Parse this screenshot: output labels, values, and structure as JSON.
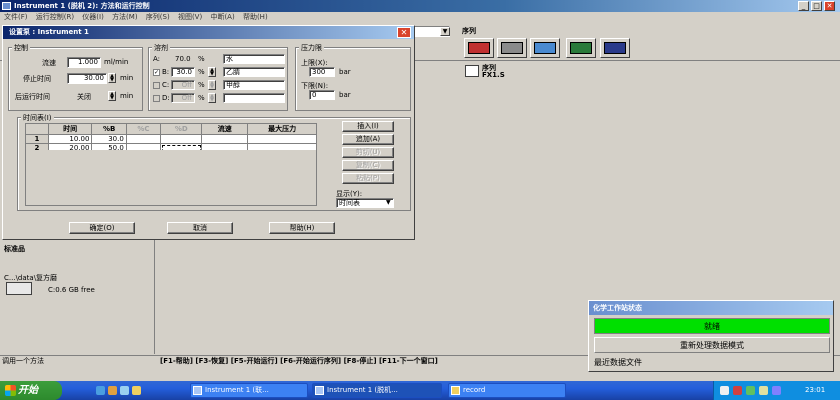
{
  "app": {
    "title": "Instrument 1 (脱机 2): 方法和运行控制",
    "menus": [
      "文件(F)",
      "运行控制(R)",
      "仪器(I)",
      "方法(M)",
      "序列(S)",
      "视图(V)",
      "中断(A)",
      "帮助(H)"
    ],
    "window_buttons": {
      "minimize": "_",
      "maximize": "□",
      "close": "✕"
    }
  },
  "toolbar": {
    "sequence_label": "序列"
  },
  "sequence_info": {
    "label": "序列",
    "value": "FX1.S"
  },
  "left_panel": {
    "standard_label": "标准品",
    "path": "C...\\data\\复方磨",
    "disk": "C:0.6 GB free"
  },
  "dialog": {
    "title": "设置泵 : Instrument 1",
    "close": "✕",
    "control": {
      "legend": "控制",
      "flow_label": "流速",
      "flow_value": "1.000",
      "flow_unit": "ml/min",
      "stop_time_label": "停止时间",
      "stop_time_value": "30.00",
      "stop_time_unit": "min",
      "post_time_label": "后运行时间",
      "post_time_value": "关闭",
      "post_time_unit": "min"
    },
    "solvents": {
      "legend": "溶剂",
      "rows": [
        {
          "key": "A:",
          "percent": "70.0",
          "unit": "%",
          "name": "水",
          "enabled": true
        },
        {
          "key": "B:",
          "percent": "30.0",
          "unit": "%",
          "name": "乙腈",
          "enabled": true
        },
        {
          "key": "C:",
          "percent": "Off",
          "unit": "%",
          "name": "甲醇",
          "enabled": false
        },
        {
          "key": "D:",
          "percent": "Off",
          "unit": "%",
          "name": "",
          "enabled": false
        }
      ]
    },
    "pressure": {
      "legend": "压力限",
      "upper_label": "上限(X):",
      "upper_value": "300",
      "upper_unit": "bar",
      "lower_label": "下限(N):",
      "lower_value": "0",
      "lower_unit": "bar"
    },
    "timetable": {
      "legend": "时间表(I)",
      "headers": [
        "",
        "时间",
        "%B",
        "%C",
        "%D",
        "流速",
        "最大压力"
      ],
      "rows": [
        {
          "index": "1",
          "time": "10.00",
          "b": "30.0"
        },
        {
          "index": "2",
          "time": "20.00",
          "b": "50.0"
        }
      ],
      "buttons": {
        "insert": "插入(I)",
        "append": "追加(A)",
        "cut": "剪切(U)",
        "copy": "复制(C)",
        "paste": "粘贴(P)"
      },
      "display_label": "显示(Y):",
      "display_value": "时间表"
    },
    "footer": {
      "ok": "确定(O)",
      "cancel": "取消",
      "help": "帮助(H)"
    }
  },
  "fkeys": "[F1-帮助] [F3-恢复] [F5-开始运行] [F6-开始运行序列] [F8-停止] [F11-下一个窗口]",
  "status_strip": "调用一个方法",
  "ws_status": {
    "title": "化学工作站状态",
    "ready": "就绪",
    "mode": "重新处理数据模式",
    "recent": "最近数据文件"
  },
  "taskbar": {
    "start": "开始",
    "tasks": [
      "Instrument 1 (联...",
      "Instrument 1 (脱机...",
      "record"
    ],
    "clock": "23:01"
  },
  "colors": {
    "title_blue": "#0a246a",
    "ready_green": "#00e000",
    "taskbar_blue": "#245edb"
  }
}
